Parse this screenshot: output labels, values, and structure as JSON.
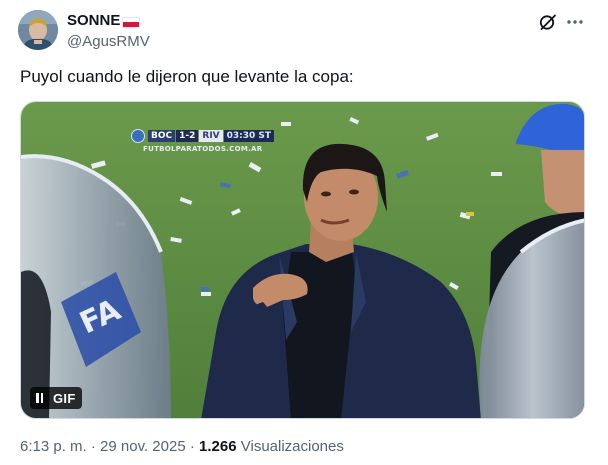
{
  "author": {
    "display_name": "SONNE",
    "handle": "@AgusRMV",
    "flag": "poland-flag"
  },
  "header_icons": {
    "grok": "grok-icon",
    "more": "more-icon"
  },
  "tweet": {
    "text": "Puyol cuando le dijeron que levante la copa:"
  },
  "media": {
    "type": "gif",
    "scorebug": {
      "team_home": "BOC",
      "score": "1-2",
      "team_away": "RIV",
      "clock": "03:30 ST"
    },
    "watermark": "FUTBOLPARATODOS.COM.AR",
    "badge": "GIF",
    "pause_icon": "pause-icon"
  },
  "meta": {
    "time": "6:13 p. m.",
    "separator": "·",
    "date": "29 nov. 2025",
    "views_count": "1.266",
    "views_label": "Visualizaciones"
  },
  "colors": {
    "text": "#0f1419",
    "secondary": "#536471",
    "border": "#cfd9de",
    "pitch": "#5f8f44"
  }
}
